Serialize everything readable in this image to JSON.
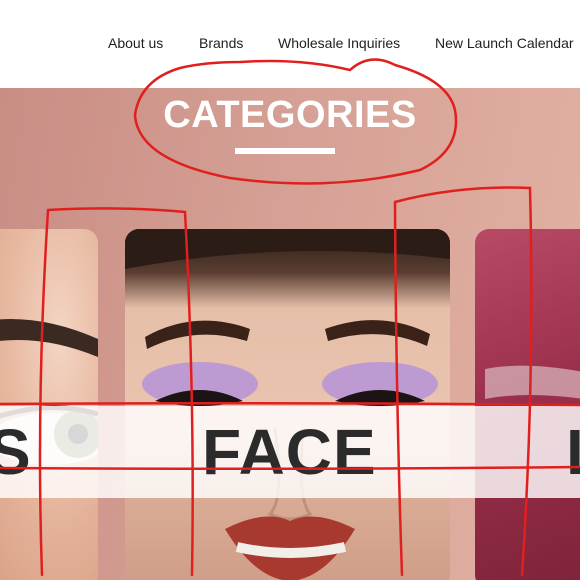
{
  "nav": {
    "items": [
      {
        "label": "About us"
      },
      {
        "label": "Brands"
      },
      {
        "label": "Wholesale Inquiries"
      },
      {
        "label": "New Launch Calendar"
      }
    ]
  },
  "section": {
    "title": "CATEGORIES"
  },
  "categories": [
    {
      "label": "S"
    },
    {
      "label": "FACE"
    },
    {
      "label": "L"
    }
  ],
  "colors": {
    "hero_background": "#d5a095",
    "annotation": "#e0201e",
    "label_text": "#2b2b2b"
  }
}
